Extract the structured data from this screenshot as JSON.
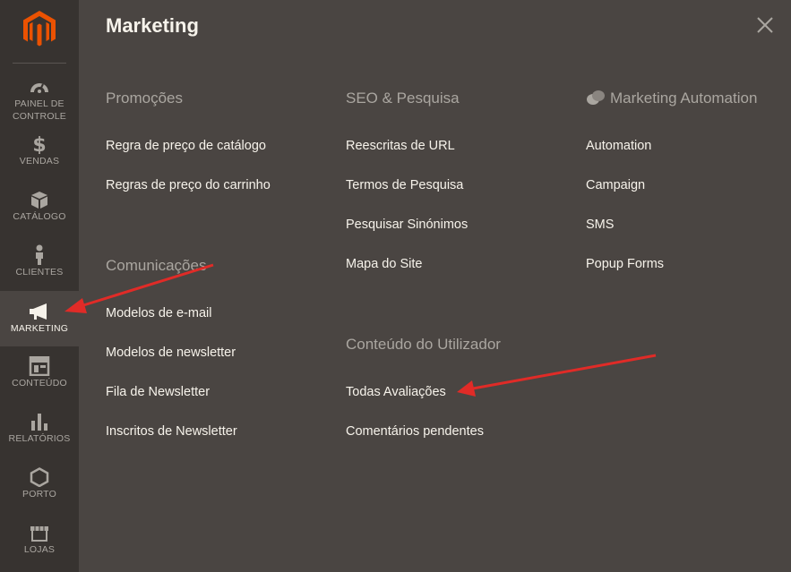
{
  "sidebar": {
    "items": [
      {
        "label": "PAINEL DE",
        "label2": "CONTROLE",
        "icon": "dashboard-icon"
      },
      {
        "label": "VENDAS",
        "icon": "dollar-icon"
      },
      {
        "label": "CATÁLOGO",
        "icon": "box-icon"
      },
      {
        "label": "CLIENTES",
        "icon": "person-icon"
      },
      {
        "label": "MARKETING",
        "icon": "megaphone-icon"
      },
      {
        "label": "CONTEÚDO",
        "icon": "layout-icon"
      },
      {
        "label": "RELATÓRIOS",
        "icon": "bar-chart-icon"
      },
      {
        "label": "PORTO",
        "icon": "hexagon-icon"
      },
      {
        "label": "LOJAS",
        "icon": "store-icon"
      }
    ]
  },
  "panel": {
    "title": "Marketing",
    "columns": [
      {
        "sections": [
          {
            "title": "Promoções",
            "links": [
              "Regra de preço de catálogo",
              "Regras de preço do carrinho"
            ]
          },
          {
            "title": "Comunicações",
            "links": [
              "Modelos de e-mail",
              "Modelos de newsletter",
              "Fila de Newsletter",
              "Inscritos de Newsletter"
            ]
          }
        ]
      },
      {
        "sections": [
          {
            "title": "SEO & Pesquisa",
            "links": [
              "Reescritas de URL",
              "Termos de Pesquisa",
              "Pesquisar Sinónimos",
              "Mapa do Site"
            ]
          },
          {
            "title": "Conteúdo do Utilizador",
            "links": [
              "Todas Avaliações",
              "Comentários pendentes"
            ]
          }
        ]
      },
      {
        "sections": [
          {
            "title": "Marketing Automation",
            "links": [
              "Automation",
              "Campaign",
              "SMS",
              "Popup Forms"
            ]
          }
        ]
      }
    ]
  },
  "colors": {
    "sidebar_bg": "#373330",
    "panel_bg": "#4a4542",
    "accent_orange": "#eb5202",
    "annotation_arrow": "#e02b27"
  }
}
